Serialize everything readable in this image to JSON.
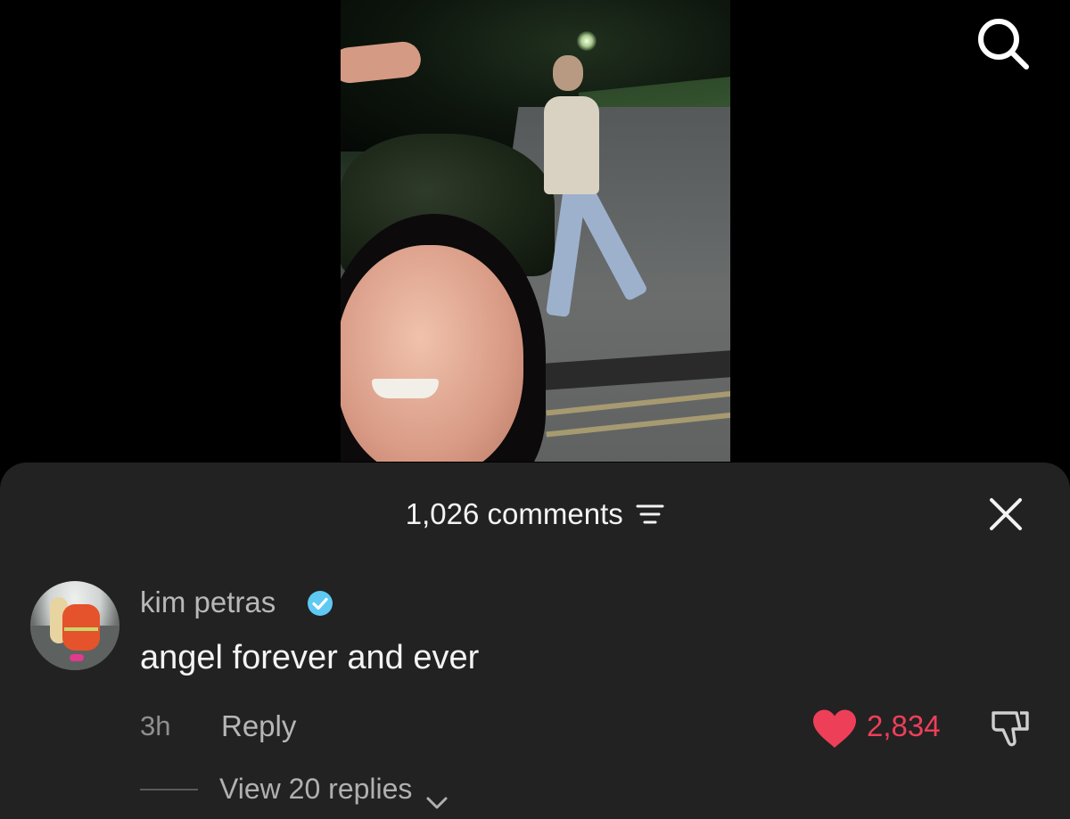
{
  "comments_panel": {
    "count_label": "1,026 comments"
  },
  "comment": {
    "username": "kim petras",
    "text": "angel forever and ever",
    "timestamp": "3h",
    "reply_label": "Reply",
    "like_count": "2,834",
    "view_replies_label": "View 20 replies"
  },
  "icons": {
    "search": "search-icon",
    "filter": "filter-icon",
    "close": "close-icon",
    "verified": "verified-badge-icon",
    "like": "heart-icon",
    "dislike": "thumbs-down-icon",
    "expand": "chevron-down-icon"
  },
  "colors": {
    "sheet_background": "#222222",
    "like_red": "#ee3f59",
    "verified_blue": "#5ec9f3"
  }
}
